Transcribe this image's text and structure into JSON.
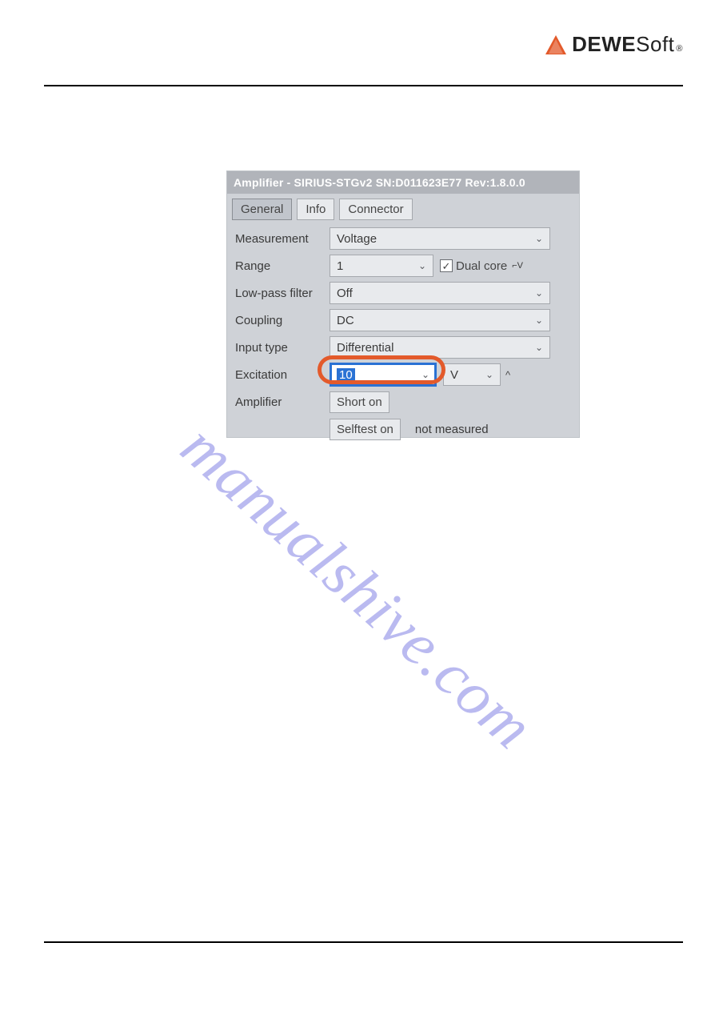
{
  "brand": {
    "name_bold": "DEWE",
    "name_light": "Soft",
    "reg": "®"
  },
  "panel": {
    "title": "Amplifier - SIRIUS-STGv2  SN:D011623E77 Rev:1.8.0.0",
    "tabs": {
      "general": "General",
      "info": "Info",
      "connector": "Connector"
    },
    "labels": {
      "measurement": "Measurement",
      "range": "Range",
      "lowpass": "Low-pass filter",
      "coupling": "Coupling",
      "input_type": "Input type",
      "excitation": "Excitation",
      "amplifier": "Amplifier"
    },
    "values": {
      "measurement": "Voltage",
      "range": "1",
      "dual_core_label": "Dual core",
      "dual_core_checked": "✓",
      "dual_core_suffix": "⌐V",
      "lowpass": "Off",
      "coupling": "DC",
      "input_type": "Differential",
      "excitation_value": "10",
      "excitation_unit": "V",
      "short_btn": "Short on",
      "selftest_btn": "Selftest on",
      "selftest_status": "not measured"
    }
  },
  "watermark": "manualshive.com"
}
